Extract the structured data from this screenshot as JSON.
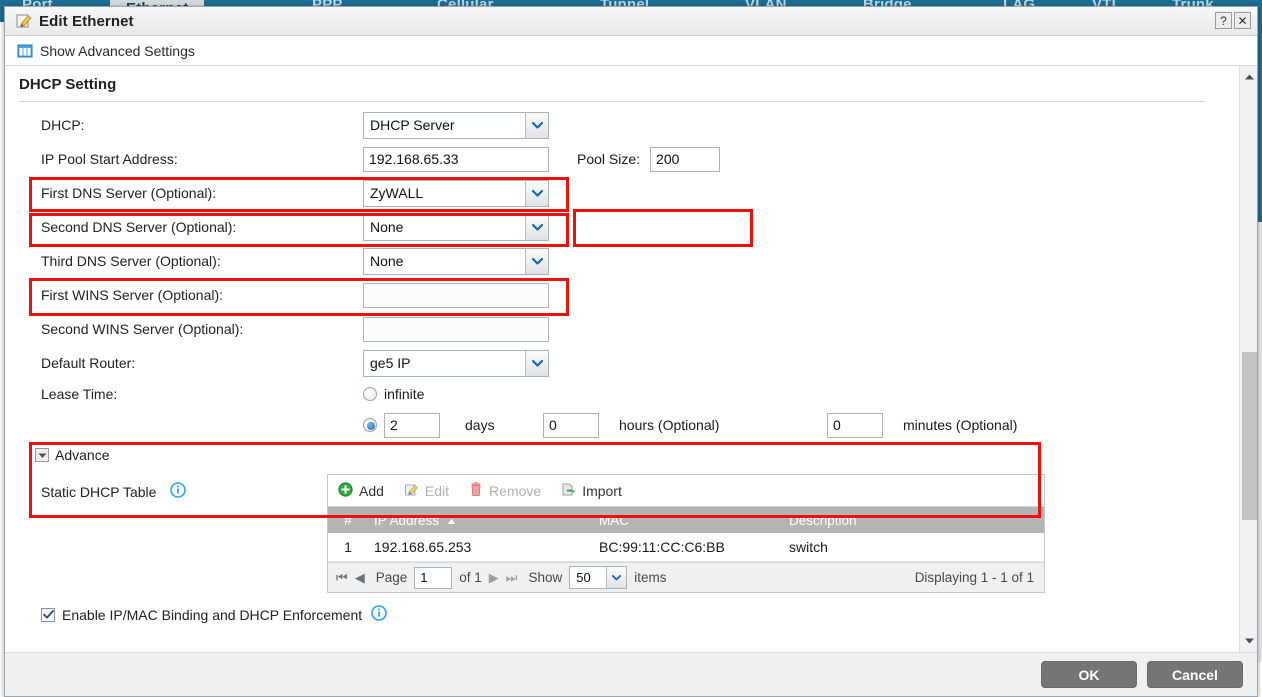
{
  "background": {
    "tabs": [
      {
        "label": "Port",
        "active": false
      },
      {
        "label": "Ethernet",
        "active": true
      },
      {
        "label": "PPP",
        "active": false
      },
      {
        "label": "Cellular",
        "active": false
      },
      {
        "label": "Tunnel",
        "active": false
      },
      {
        "label": "VLAN",
        "active": false
      },
      {
        "label": "Bridge",
        "active": false
      },
      {
        "label": "LAG",
        "active": false
      },
      {
        "label": "VTI",
        "active": false
      },
      {
        "label": "Trunk",
        "active": false
      }
    ]
  },
  "window": {
    "title": "Edit Ethernet",
    "title_icon": "edit-pencil-icon",
    "help_button": "?",
    "close_button": "✕"
  },
  "toolbar": {
    "advanced_settings_label": "Show Advanced Settings",
    "advanced_settings_icon": "grid-table-icon"
  },
  "section": {
    "title": "DHCP Setting"
  },
  "form": {
    "dhcp": {
      "label": "DHCP:",
      "value": "DHCP Server",
      "type": "select"
    },
    "ip_pool_start": {
      "label": "IP Pool Start Address:",
      "value": "192.168.65.33",
      "type": "text"
    },
    "pool_size": {
      "label": "Pool Size:",
      "value": "200",
      "type": "text"
    },
    "first_dns": {
      "label": "First DNS Server (Optional):",
      "value": "ZyWALL",
      "type": "select"
    },
    "second_dns": {
      "label": "Second DNS Server (Optional):",
      "value": "None",
      "type": "select"
    },
    "third_dns": {
      "label": "Third DNS Server (Optional):",
      "value": "None",
      "type": "select"
    },
    "first_wins": {
      "label": "First WINS Server (Optional):",
      "value": "",
      "type": "text"
    },
    "second_wins": {
      "label": "Second WINS Server (Optional):",
      "value": "",
      "type": "text"
    },
    "default_router": {
      "label": "Default Router:",
      "value": "ge5 IP",
      "type": "select"
    },
    "lease_time": {
      "label": "Lease Time:",
      "infinite_label": "infinite",
      "infinite_selected": false,
      "duration_selected": true,
      "days_value": "2",
      "days_label": "days",
      "hours_value": "0",
      "hours_label": "hours (Optional)",
      "minutes_value": "0",
      "minutes_label": "minutes (Optional)"
    }
  },
  "advance": {
    "label": "Advance",
    "expanded": true
  },
  "static_dhcp": {
    "label": "Static DHCP Table",
    "info_icon": "info-icon",
    "toolbar": [
      {
        "label": "Add",
        "icon": "add-plus-icon",
        "enabled": true
      },
      {
        "label": "Edit",
        "icon": "edit-pencil-icon",
        "enabled": false
      },
      {
        "label": "Remove",
        "icon": "trash-icon",
        "enabled": false
      },
      {
        "label": "Import",
        "icon": "import-icon",
        "enabled": true
      }
    ],
    "columns": [
      "#",
      "IP Address",
      "MAC",
      "Description"
    ],
    "sorted_column": "IP Address",
    "sort_direction": "asc",
    "rows": [
      {
        "num": "1",
        "ip": "192.168.65.253",
        "mac": "BC:99:11:CC:C6:BB",
        "description": "switch"
      }
    ],
    "pager": {
      "page_label": "Page",
      "page_value": "1",
      "of_label": "of 1",
      "show_label": "Show",
      "show_value": "50",
      "items_label": "items",
      "displaying": "Displaying 1 - 1 of 1"
    }
  },
  "enforcement": {
    "label": "Enable IP/MAC Binding and DHCP Enforcement",
    "checked": true,
    "info_icon": "info-icon"
  },
  "footer": {
    "ok_label": "OK",
    "cancel_label": "Cancel"
  },
  "colors": {
    "highlight": "#e8130f",
    "tabstrip": "#1c6e93",
    "button": "#757575",
    "table_header": "#b4b4b4",
    "info": "#2ba6e0"
  }
}
